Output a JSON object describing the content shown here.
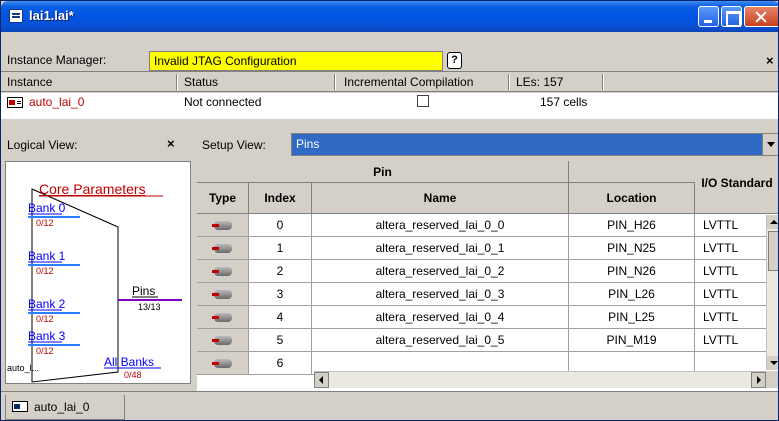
{
  "window": {
    "title": "lai1.lai*"
  },
  "instance_manager": {
    "label": "Instance Manager:",
    "status_text": "Invalid JTAG Configuration",
    "help_label": "?"
  },
  "instance_table": {
    "headers": {
      "instance": "Instance",
      "status": "Status",
      "incremental": "Incremental Compilation",
      "les": "LEs: 157"
    },
    "rows": [
      {
        "name": "auto_lai_0",
        "status": "Not connected",
        "incremental_checked": false,
        "les": "157 cells"
      }
    ]
  },
  "logical_view": {
    "title": "Logical View:",
    "close_label": "×",
    "core_parameters": "Core Parameters",
    "banks": [
      {
        "label": "Bank 0",
        "count": "0/12"
      },
      {
        "label": "Bank 1",
        "count": "0/12"
      },
      {
        "label": "Bank 2",
        "count": "0/12"
      },
      {
        "label": "Bank 3",
        "count": "0/12"
      }
    ],
    "pins_label": "Pins",
    "pins_count": "13/13",
    "all_banks_label": "All Banks",
    "all_banks_count": "0/48",
    "instance_short": "auto_l..."
  },
  "setup_view": {
    "label": "Setup View:",
    "selected": "Pins"
  },
  "pin_table": {
    "group_header": "Pin",
    "io_header": "I/O Standard",
    "columns": {
      "type": "Type",
      "index": "Index",
      "name": "Name",
      "location": "Location"
    },
    "rows": [
      {
        "index": "0",
        "name": "altera_reserved_lai_0_0",
        "location": "PIN_H26",
        "io": "LVTTL"
      },
      {
        "index": "1",
        "name": "altera_reserved_lai_0_1",
        "location": "PIN_N25",
        "io": "LVTTL"
      },
      {
        "index": "2",
        "name": "altera_reserved_lai_0_2",
        "location": "PIN_N26",
        "io": "LVTTL"
      },
      {
        "index": "3",
        "name": "altera_reserved_lai_0_3",
        "location": "PIN_L26",
        "io": "LVTTL"
      },
      {
        "index": "4",
        "name": "altera_reserved_lai_0_4",
        "location": "PIN_L25",
        "io": "LVTTL"
      },
      {
        "index": "5",
        "name": "altera_reserved_lai_0_5",
        "location": "PIN_M19",
        "io": "LVTTL"
      },
      {
        "index": "6",
        "name": "",
        "location": "",
        "io": ""
      }
    ]
  },
  "bottom_tab": {
    "label": "auto_lai_0"
  },
  "colors": {
    "title_bar": "#0054e3",
    "field_highlight": "#ffff00",
    "selection_blue": "#316ac5",
    "instance_red": "#c00000",
    "bank_blue": "#0000ff",
    "pins_purple": "#8000c0"
  }
}
